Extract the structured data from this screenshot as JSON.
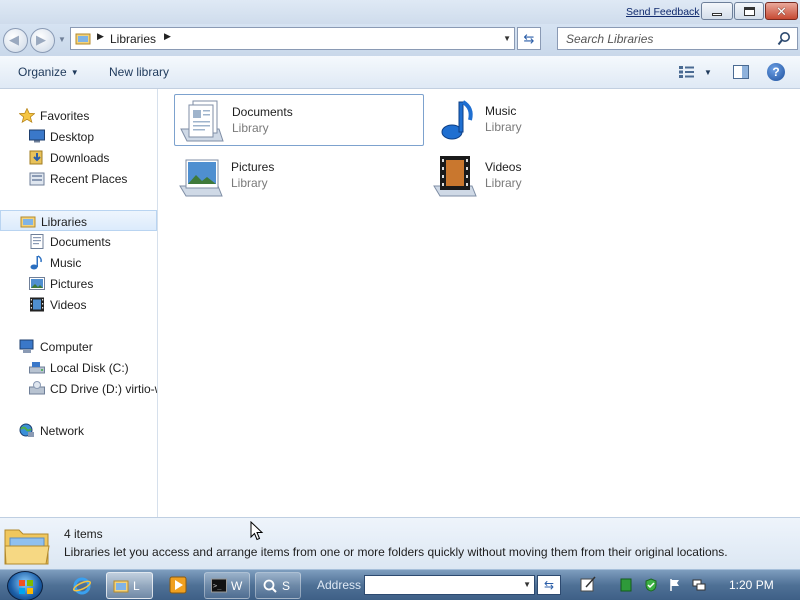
{
  "titlebar": {
    "send_feedback": "Send Feedback"
  },
  "address": {
    "root_label": "Libraries",
    "search_placeholder": "Search Libraries"
  },
  "toolbar": {
    "organize_label": "Organize",
    "new_library_label": "New library"
  },
  "nav": {
    "favorites": "Favorites",
    "desktop": "Desktop",
    "downloads": "Downloads",
    "recent_places": "Recent Places",
    "libraries": "Libraries",
    "documents": "Documents",
    "music": "Music",
    "pictures": "Pictures",
    "videos": "Videos",
    "computer": "Computer",
    "local_disk": "Local Disk (C:)",
    "cd_drive": "CD Drive (D:) virtio-w",
    "network": "Network"
  },
  "content": {
    "items": [
      {
        "name": "Documents",
        "type": "Library"
      },
      {
        "name": "Music",
        "type": "Library"
      },
      {
        "name": "Pictures",
        "type": "Library"
      },
      {
        "name": "Videos",
        "type": "Library"
      }
    ]
  },
  "details": {
    "count": "4 items",
    "description": "Libraries let you access and arrange items from one or more folders quickly without moving them from their original locations."
  },
  "taskbar": {
    "explorer_label": "L",
    "cmd_label": "W",
    "search_label": "S",
    "address_label": "Address",
    "clock": "1:20 PM"
  },
  "colors": {
    "accent": "#2b5ea8",
    "selection_border": "#7da2ce",
    "taskbar": "#4f7196"
  }
}
